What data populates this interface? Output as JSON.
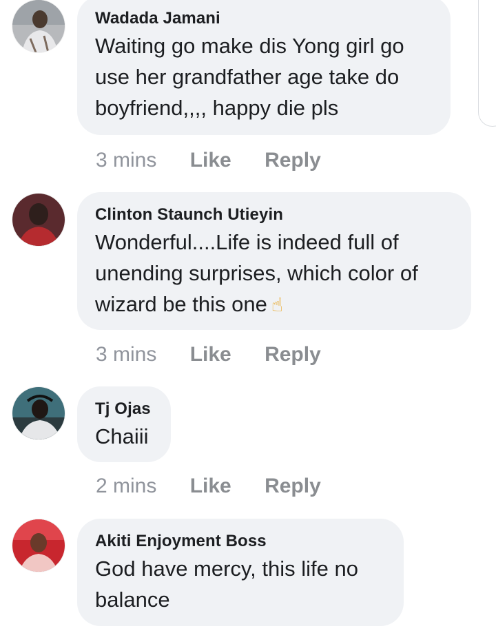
{
  "comments": [
    {
      "author": "Wadada Jamani",
      "text": "Waiting go make dis Yong girl go use her grandfather age take do boyfriend,,,, happy die pls",
      "time": "3 mins",
      "like": "Like",
      "reply": "Reply"
    },
    {
      "author": "Clinton Staunch Utieyin",
      "text": "Wonderful....Life is indeed full of unending surprises, which color of wizard be this one",
      "emoji": "☝",
      "time": "3 mins",
      "like": "Like",
      "reply": "Reply"
    },
    {
      "author": "Tj Ojas",
      "text": "Chaiii",
      "time": "2 mins",
      "like": "Like",
      "reply": "Reply"
    },
    {
      "author": "Akiti Enjoyment Boss",
      "text": "God have mercy,  this life no balance"
    }
  ],
  "colors": {
    "bubble": "#f0f2f5",
    "author": "#1c1e21",
    "meta": "#8a8d91"
  }
}
